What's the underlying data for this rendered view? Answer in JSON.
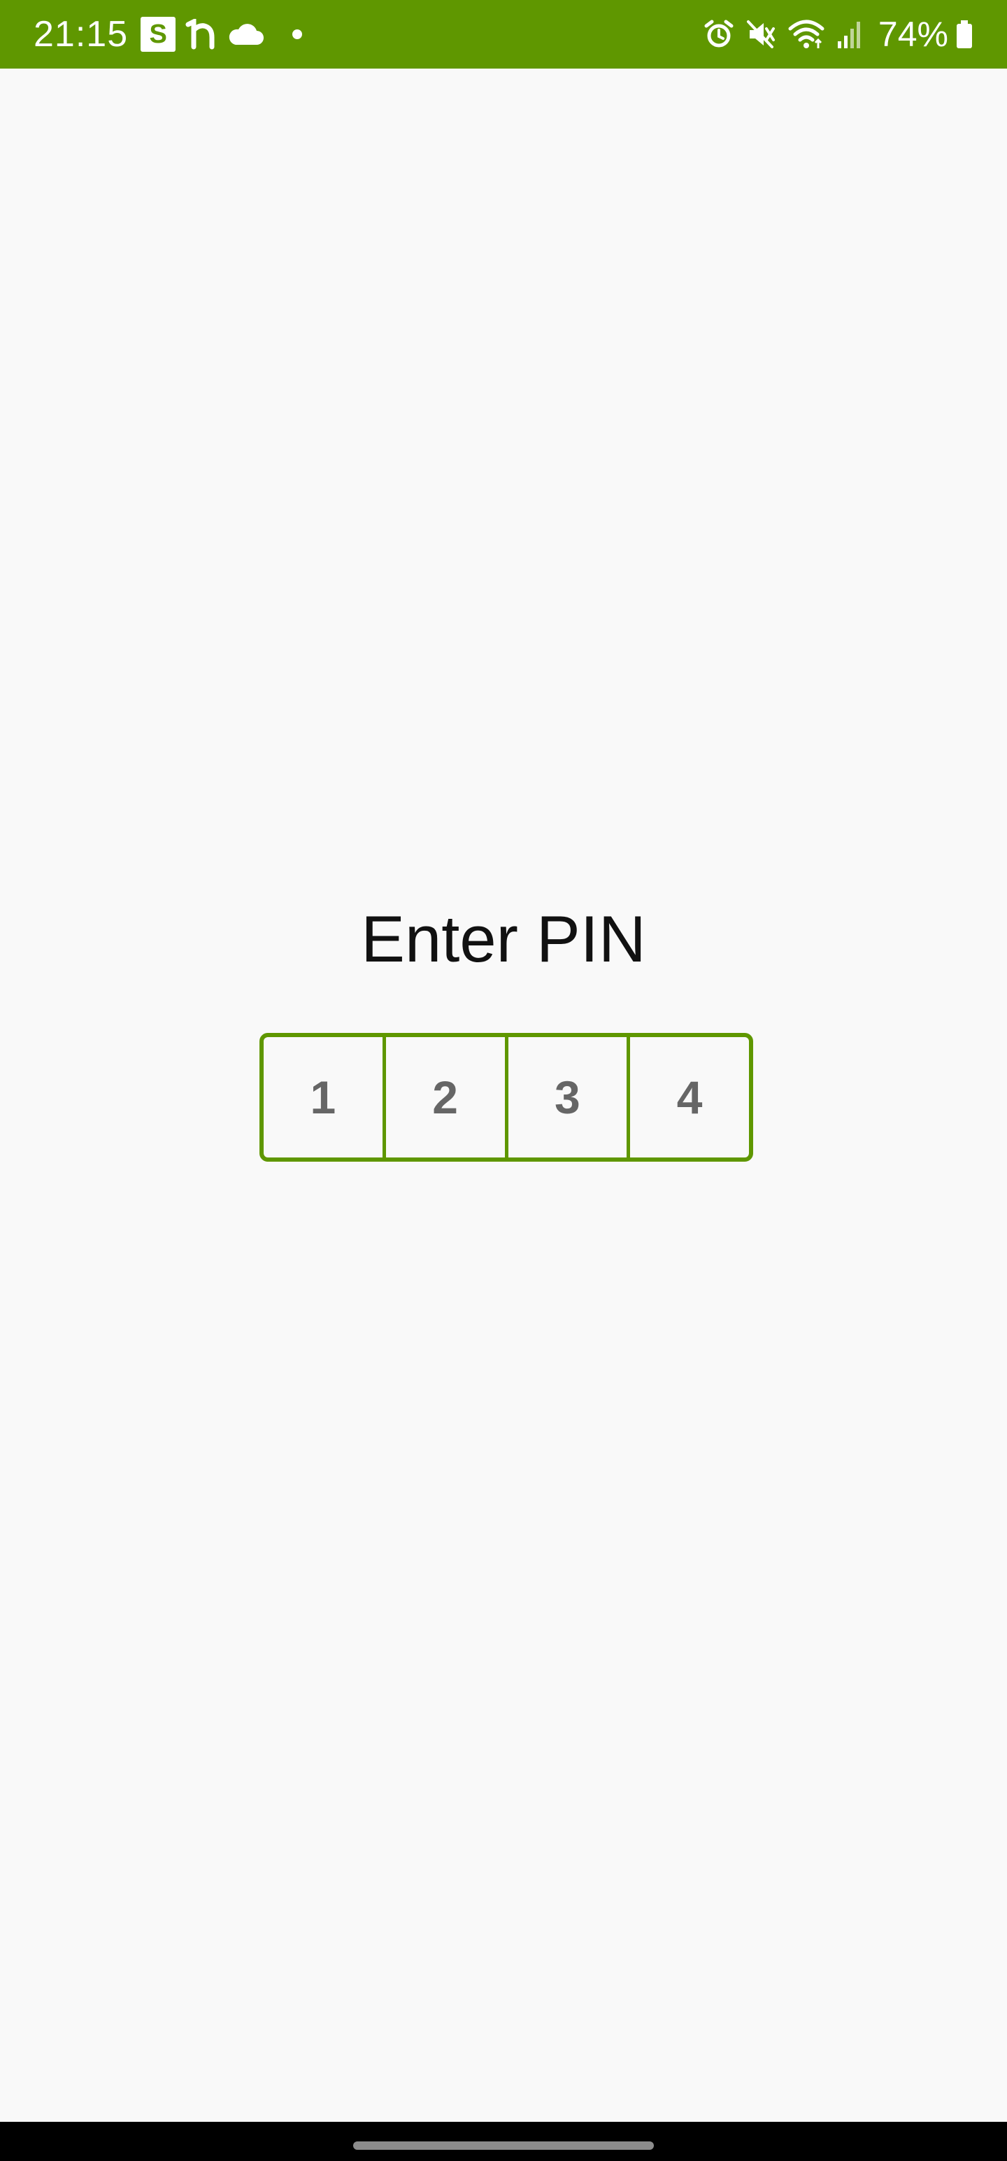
{
  "status_bar": {
    "time": "21:15",
    "s_icon_label": "S",
    "battery_percent": "74%",
    "bar_color": "#5f9700",
    "icons_left": [
      "s-app-icon",
      "n-app-icon",
      "cloud-icon",
      "dot-icon"
    ],
    "icons_right": [
      "alarm-icon",
      "mute-icon",
      "wifi-icon",
      "signal-icon",
      "battery-icon"
    ]
  },
  "pin": {
    "title": "Enter PIN",
    "digits": [
      "1",
      "2",
      "3",
      "4"
    ],
    "accent_color": "#5f9700"
  }
}
